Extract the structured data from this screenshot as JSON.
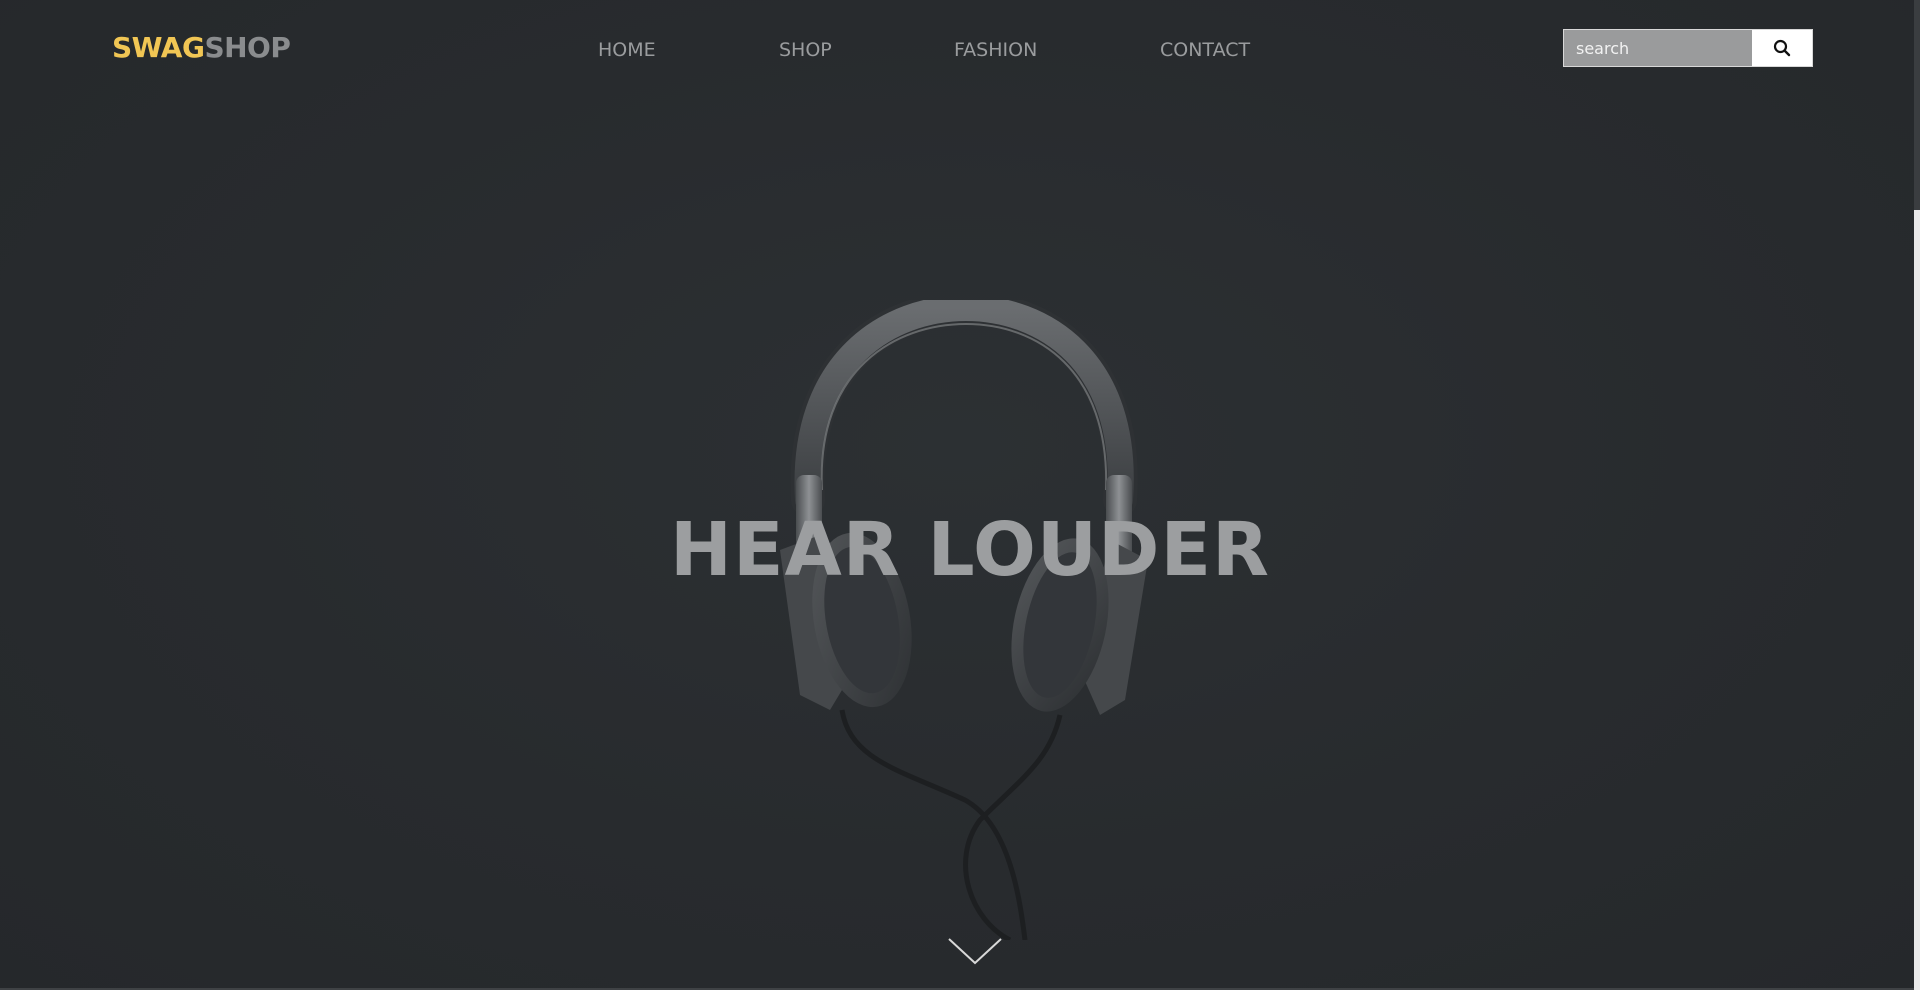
{
  "brand": {
    "part1": "SWAG",
    "part2": "SHOP",
    "accent_color": "#f1c654",
    "muted_color": "#8a8c8e"
  },
  "nav": {
    "items": [
      {
        "label": "HOME"
      },
      {
        "label": "SHOP"
      },
      {
        "label": "FASHION"
      },
      {
        "label": "CONTACT"
      }
    ]
  },
  "search": {
    "placeholder": "search",
    "button_icon": "search-icon"
  },
  "hero": {
    "title": "HEAR LOUDER",
    "image": "headphones-image",
    "scroll_icon": "chevron-down-icon"
  },
  "colors": {
    "background": "#282b2e",
    "text": "#9c9ea0"
  }
}
